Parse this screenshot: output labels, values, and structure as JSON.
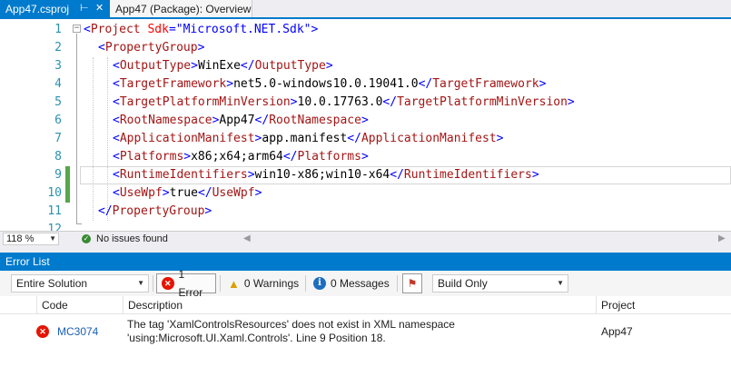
{
  "tabs": [
    {
      "label": "App47.csproj",
      "active": true
    },
    {
      "label": "App47 (Package): Overview",
      "active": false
    }
  ],
  "editor": {
    "lines": [
      {
        "num": "1",
        "changed": false
      },
      {
        "num": "2",
        "changed": false
      },
      {
        "num": "3",
        "changed": false
      },
      {
        "num": "4",
        "changed": false
      },
      {
        "num": "5",
        "changed": false
      },
      {
        "num": "6",
        "changed": false
      },
      {
        "num": "7",
        "changed": false
      },
      {
        "num": "8",
        "changed": false
      },
      {
        "num": "9",
        "changed": true
      },
      {
        "num": "10",
        "changed": true
      },
      {
        "num": "11",
        "changed": false
      },
      {
        "num": "12",
        "changed": false
      }
    ],
    "code": {
      "project_tag": "Project",
      "sdk_attr": "Sdk",
      "sdk_value": "\"Microsoft.NET.Sdk\"",
      "property_group": "PropertyGroup",
      "output_type_tag": "OutputType",
      "output_type_value": "WinExe",
      "target_framework_tag": "TargetFramework",
      "target_framework_value": "net5.0-windows10.0.19041.0",
      "min_version_tag": "TargetPlatformMinVersion",
      "min_version_value": "10.0.17763.0",
      "root_ns_tag": "RootNamespace",
      "root_ns_value": "App47",
      "manifest_tag": "ApplicationManifest",
      "manifest_value": "app.manifest",
      "platforms_tag": "Platforms",
      "platforms_value": "x86;x64;arm64",
      "runtime_tag": "RuntimeIdentifiers",
      "runtime_value": "win10-x86;win10-x64",
      "use_wpf_tag": "UseWpf",
      "use_wpf_value": "true"
    },
    "colors": {
      "bracket": "#0000ff",
      "tag": "#a31515",
      "attribute": "#ff0000",
      "line_number": "#2b91af",
      "change_marker": "#57a64a"
    }
  },
  "status": {
    "zoom": "118 %",
    "issues": "No issues found"
  },
  "error_list": {
    "title": "Error List",
    "scope": "Entire Solution",
    "errors_label": "1 Error",
    "warnings_label": "0 Warnings",
    "messages_label": "0 Messages",
    "build_filter": "Build Only",
    "columns": {
      "code": "Code",
      "description": "Description",
      "project": "Project"
    },
    "rows": [
      {
        "code": "MC3074",
        "description_line1": "The tag 'XamlControlsResources' does not exist in XML namespace",
        "description_line2": "'using:Microsoft.UI.Xaml.Controls'. Line 9 Position 18.",
        "project": "App47"
      }
    ],
    "accent": "#007acc",
    "error_color": "#e51400"
  }
}
